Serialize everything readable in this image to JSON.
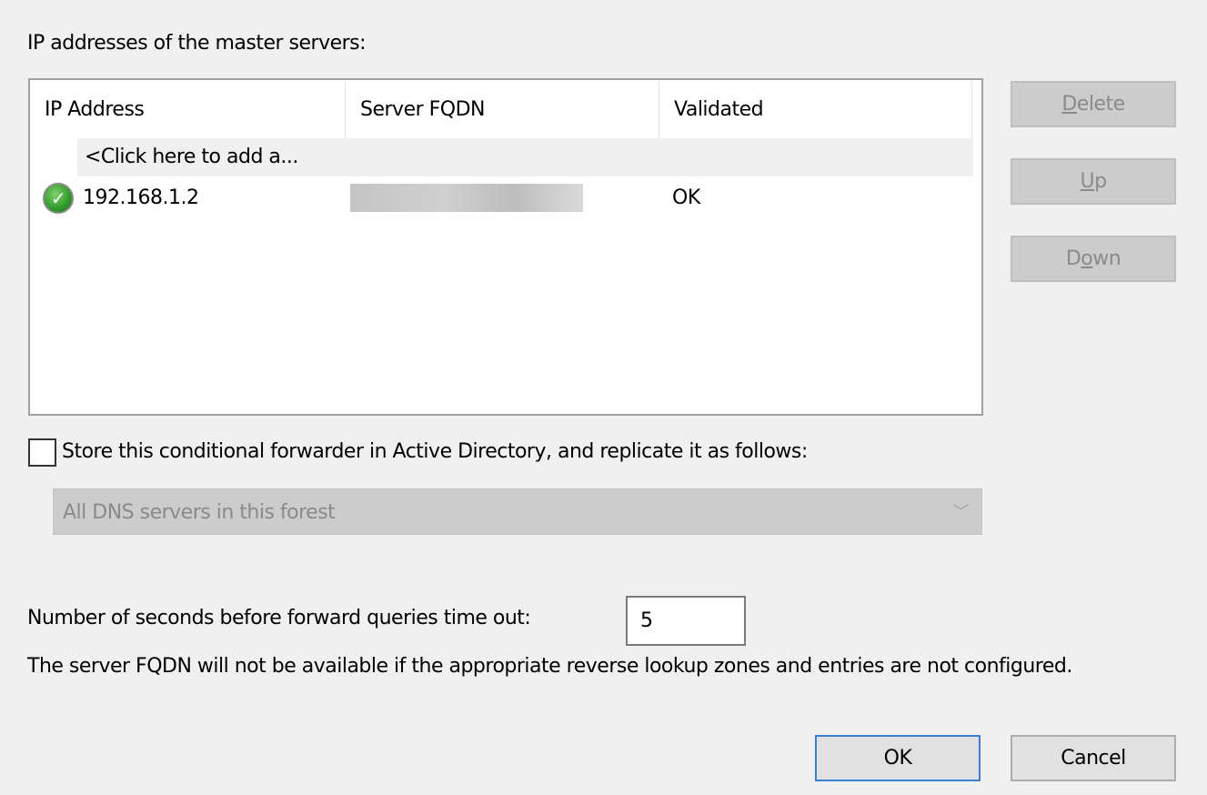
{
  "dialog": {
    "master_label": "IP addresses of the master servers:",
    "table": {
      "columns": [
        "IP Address",
        "Server FQDN",
        "Validated"
      ],
      "add_row": "<Click here to add a...",
      "rows": [
        {
          "status_icon": "green-check-icon",
          "ip": "192.168.1.2",
          "fqdn": "",
          "validated": "OK"
        }
      ]
    },
    "buttons": {
      "delete": {
        "mnemonic": "D",
        "rest": "elete"
      },
      "up": {
        "mnemonic": "U",
        "rest": "p"
      },
      "down": {
        "pre": "D",
        "mnemonic": "o",
        "rest": "wn"
      },
      "ok": "OK",
      "cancel": "Cancel"
    },
    "store_checkbox": {
      "label": "Store this conditional forwarder in Active Directory, and replicate it as follows:",
      "checked": false
    },
    "replication_select": {
      "value": "All DNS servers in this forest",
      "disabled": true
    },
    "timeout": {
      "label": "Number of seconds before forward queries time out:",
      "value": "5"
    },
    "note": "The server FQDN will not be available if the appropriate reverse lookup zones and entries are not configured."
  }
}
